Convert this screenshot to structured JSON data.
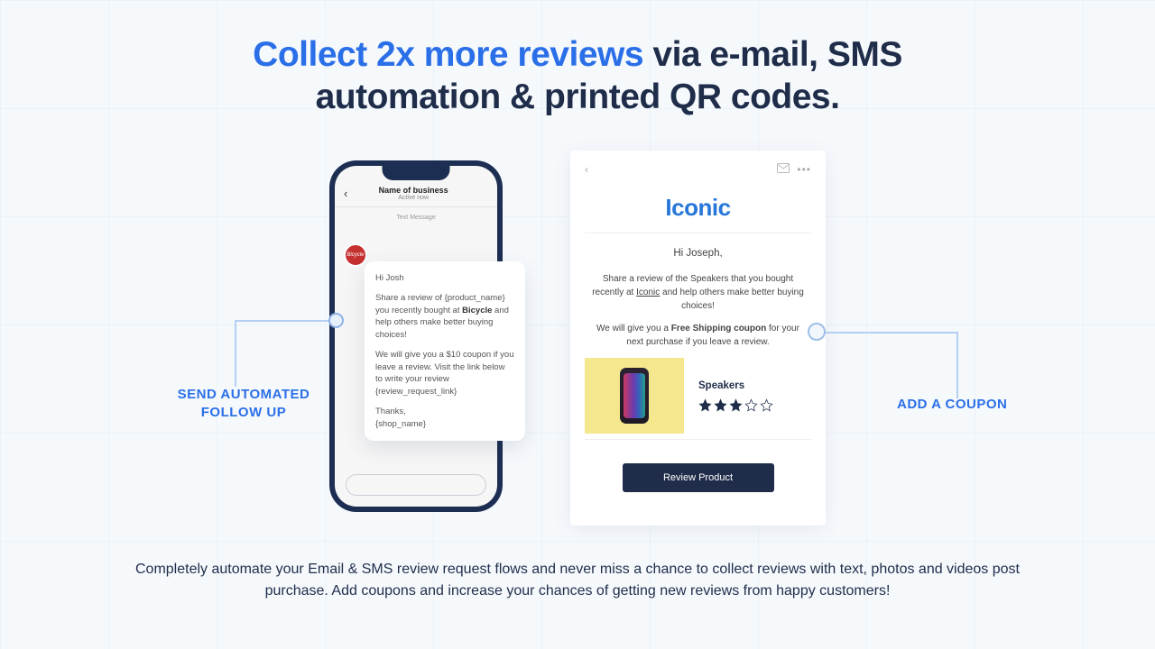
{
  "headline": {
    "highlight": "Collect 2x more reviews",
    "rest": " via e-mail, SMS automation & printed QR codes."
  },
  "callouts": {
    "left_line1": "SEND AUTOMATED",
    "left_line2": "FOLLOW UP",
    "right": "ADD A COUPON"
  },
  "phone": {
    "title": "Name of business",
    "sub": "Active now",
    "msg_label": "Text Message",
    "avatar_text": "Bicycle"
  },
  "sms": {
    "greeting": "Hi Josh",
    "body1_a": "Share a review of {product_name} you recently bought at ",
    "body1_bold": "Bicycle",
    "body1_b": " and help others make better buying choices!",
    "body2": "We will give you a $10 coupon if you leave a review. Visit the link below to write your review {review_request_link}",
    "thanks": "Thanks,",
    "shop": "{shop_name}"
  },
  "email": {
    "brand": "Iconic",
    "greeting": "Hi Joseph,",
    "line1_a": "Share a review of the Speakers that you bought recently at ",
    "line1_brand": "Iconic",
    "line1_b": " and help others make better buying choices!",
    "line2_a": "We will give you a ",
    "line2_bold": "Free Shipping coupon",
    "line2_b": " for your next purchase if you leave a review.",
    "product_name": "Speakers",
    "rating_filled": 3,
    "rating_total": 5,
    "button": "Review Product"
  },
  "footer": "Completely automate your Email & SMS review request flows and never miss a chance to collect reviews with text, photos and videos post purchase. Add coupons and increase your chances of getting new reviews from happy customers!"
}
